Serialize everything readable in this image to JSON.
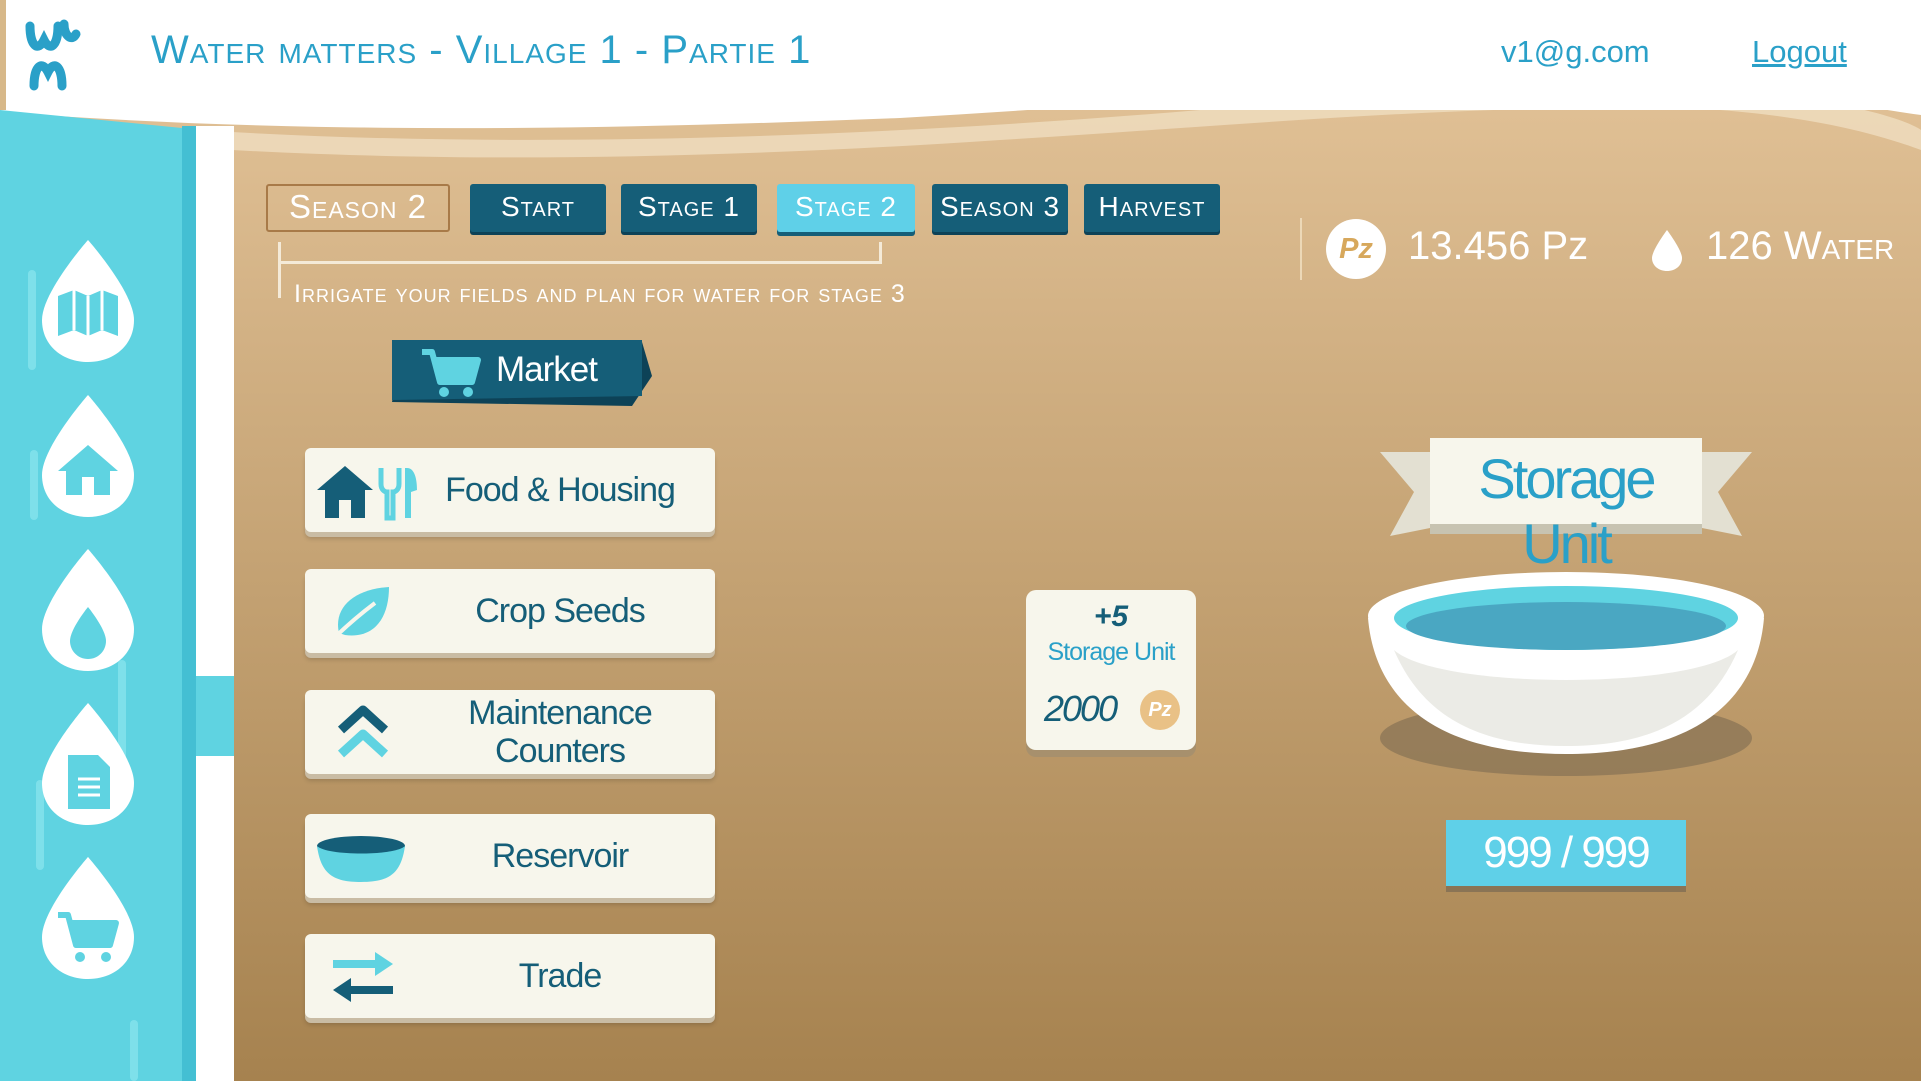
{
  "header": {
    "title": "Water matters - Village 1 - Partie 1",
    "user_email": "v1@g.com",
    "logout_label": "Logout"
  },
  "sidebar": {
    "items": [
      {
        "name": "map",
        "icon": "map-icon"
      },
      {
        "name": "home",
        "icon": "house-icon"
      },
      {
        "name": "water",
        "icon": "water-drop-icon"
      },
      {
        "name": "document",
        "icon": "document-icon"
      },
      {
        "name": "market",
        "icon": "cart-icon"
      }
    ]
  },
  "stages": {
    "current_season": "Season 2",
    "tabs": [
      {
        "label": "Start",
        "active": false
      },
      {
        "label": "Stage 1",
        "active": false
      },
      {
        "label": "Stage 2",
        "active": true
      },
      {
        "label": "Season 3",
        "active": false
      },
      {
        "label": "Harvest",
        "active": false
      }
    ],
    "instruction": "Irrigate your fields and plan for water for stage 3"
  },
  "resources": {
    "pz_icon_label": "Pz",
    "pz_amount": "13.456 Pz",
    "water_amount": "126 Water"
  },
  "market": {
    "title": "Market",
    "categories": [
      {
        "label": "Food & Housing",
        "icon": "house-utensils-icon"
      },
      {
        "label": "Crop Seeds",
        "icon": "leaf-icon"
      },
      {
        "label": "Maintenance Counters",
        "icon": "double-chevron-up-icon"
      },
      {
        "label": "Reservoir",
        "icon": "reservoir-bowl-icon"
      },
      {
        "label": "Trade",
        "icon": "trade-arrows-icon"
      }
    ]
  },
  "item": {
    "quantity": "+5",
    "name": "Storage Unit",
    "price": "2000",
    "currency": "Pz"
  },
  "storage": {
    "title": "Storage Unit",
    "counter": "999 / 999"
  },
  "colors": {
    "accent": "#2aa0c8",
    "dark_teal": "#155e78",
    "light_cyan": "#5fd0e8",
    "sand_top": "#dfbe92",
    "sand_bottom": "#a5814f"
  }
}
